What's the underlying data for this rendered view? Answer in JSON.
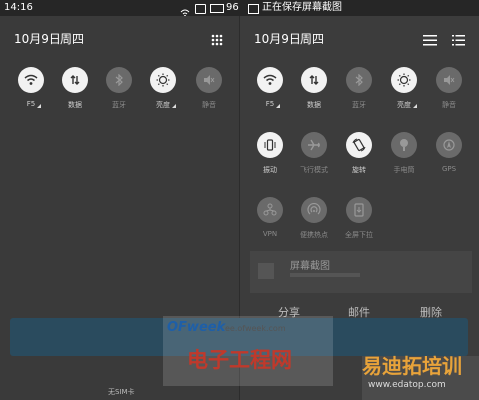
{
  "statusbar": {
    "time": "14:16",
    "battery": "96",
    "notification": "正在保存屏幕截图"
  },
  "left": {
    "date": "10月9日",
    "weekday": "周四",
    "tiles": [
      {
        "label": "F5",
        "icon": "wifi-icon",
        "state": "on"
      },
      {
        "label": "数据",
        "icon": "data-icon",
        "state": "on"
      },
      {
        "label": "蓝牙",
        "icon": "bluetooth-icon",
        "state": "off"
      },
      {
        "label": "亮度",
        "icon": "brightness-icon",
        "state": "on"
      },
      {
        "label": "静音",
        "icon": "mute-icon",
        "state": "off"
      }
    ],
    "sim_label": "无SIM卡"
  },
  "right": {
    "date": "10月9日",
    "weekday": "周四",
    "row1": [
      {
        "label": "F5",
        "icon": "wifi-icon",
        "state": "on"
      },
      {
        "label": "数据",
        "icon": "data-icon",
        "state": "on"
      },
      {
        "label": "蓝牙",
        "icon": "bluetooth-icon",
        "state": "off"
      },
      {
        "label": "亮度",
        "icon": "brightness-icon",
        "state": "on"
      },
      {
        "label": "静音",
        "icon": "mute-icon",
        "state": "off"
      }
    ],
    "row2": [
      {
        "label": "振动",
        "icon": "vibrate-icon",
        "state": "on"
      },
      {
        "label": "飞行模式",
        "icon": "airplane-icon",
        "state": "off"
      },
      {
        "label": "旋转",
        "icon": "rotate-icon",
        "state": "on"
      },
      {
        "label": "手电筒",
        "icon": "flashlight-icon",
        "state": "off"
      },
      {
        "label": "GPS",
        "icon": "gps-icon",
        "state": "off"
      }
    ],
    "row3": [
      {
        "label": "VPN",
        "icon": "vpn-icon",
        "state": "off"
      },
      {
        "label": "便携热点",
        "icon": "hotspot-icon",
        "state": "off"
      },
      {
        "label": "全屏下拉",
        "icon": "fullscreen-pull-icon",
        "state": "off"
      }
    ],
    "screenshot_title": "屏幕截图",
    "actions": [
      "分享",
      "邮件",
      "删除"
    ]
  },
  "watermarks": {
    "brand": "OFweek",
    "site": "ee.ofweek.com",
    "cn_name": "电子工程网",
    "corner_text": "易迪拓培训",
    "corner_url": "www.edatop.com"
  }
}
